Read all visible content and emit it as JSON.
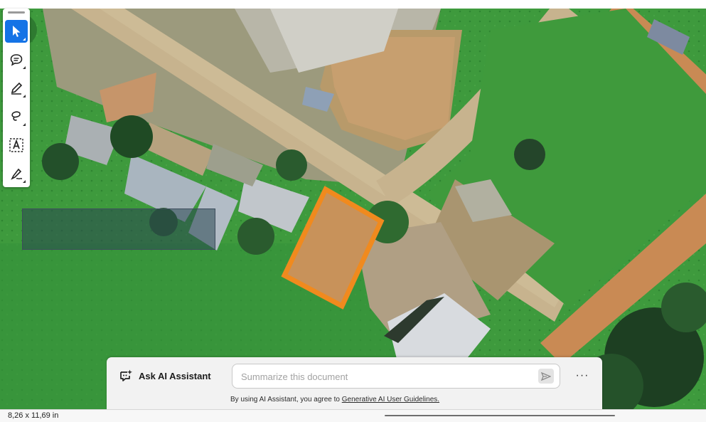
{
  "toolbar": {
    "tools": [
      {
        "name": "select-tool",
        "icon": "cursor-arrow-icon",
        "active": true
      },
      {
        "name": "comment-tool",
        "icon": "comment-bubble-icon",
        "active": false
      },
      {
        "name": "draw-tool",
        "icon": "pencil-icon",
        "active": false
      },
      {
        "name": "lasso-tool",
        "icon": "lasso-icon",
        "active": false
      },
      {
        "name": "text-select-tool",
        "icon": "text-box-icon",
        "active": false
      },
      {
        "name": "sign-tool",
        "icon": "pen-sign-icon",
        "active": false
      }
    ],
    "active_color": "#1473e6"
  },
  "ai_assistant": {
    "label": "Ask AI Assistant",
    "icon": "ai-sparkle-chat-icon",
    "input_placeholder": "Summarize this document",
    "input_value": "",
    "send_icon": "send-arrow-icon",
    "more_label": "···",
    "disclaimer_prefix": "By using AI Assistant, you agree to ",
    "disclaimer_link": "Generative AI User Guidelines."
  },
  "document": {
    "annotation_colors": {
      "plot_outline": "#f08a1e",
      "rect_fill": "#284650"
    }
  },
  "statusbar": {
    "page_size": "8,26 x 11,69 in"
  }
}
